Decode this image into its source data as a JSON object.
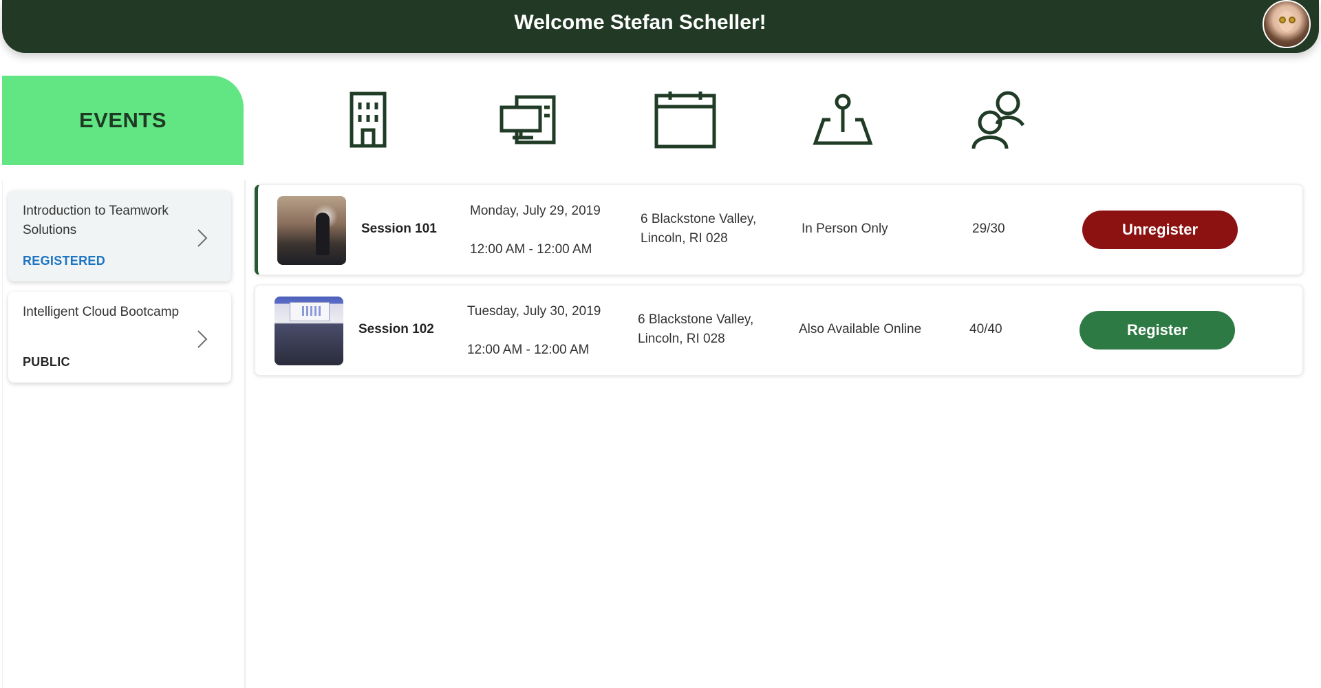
{
  "header": {
    "welcome_text": "Welcome Stefan Scheller!"
  },
  "events_tab": {
    "label": "EVENTS"
  },
  "top_icons": [
    {
      "name": "building-icon"
    },
    {
      "name": "devices-icon"
    },
    {
      "name": "calendar-icon"
    },
    {
      "name": "map-pin-icon"
    },
    {
      "name": "people-icon"
    }
  ],
  "events": [
    {
      "name": "Introduction to Teamwork Solutions",
      "status": "REGISTERED",
      "selected": true
    },
    {
      "name": "Intelligent Cloud Bootcamp",
      "status": "PUBLIC",
      "selected": false
    }
  ],
  "sessions": [
    {
      "name": "Session 101",
      "date": "Monday, July 29, 2019",
      "time": "12:00 AM - 12:00 AM",
      "address": "6 Blackstone Valley, Lincoln, RI 028",
      "mode": "In Person Only",
      "capacity": "29/30",
      "action": "Unregister"
    },
    {
      "name": "Session 102",
      "date": "Tuesday, July 30, 2019",
      "time": "12:00 AM - 12:00 AM",
      "address": "6 Blackstone Valley, Lincoln, RI 028",
      "mode": "Also Available Online",
      "capacity": "40/40",
      "action": "Register"
    }
  ],
  "colors": {
    "header_bg": "#223a25",
    "events_tab_bg": "#62e684",
    "registered_status": "#1c74c2",
    "unregister_button": "#8c1212",
    "register_button": "#2e7a44"
  }
}
